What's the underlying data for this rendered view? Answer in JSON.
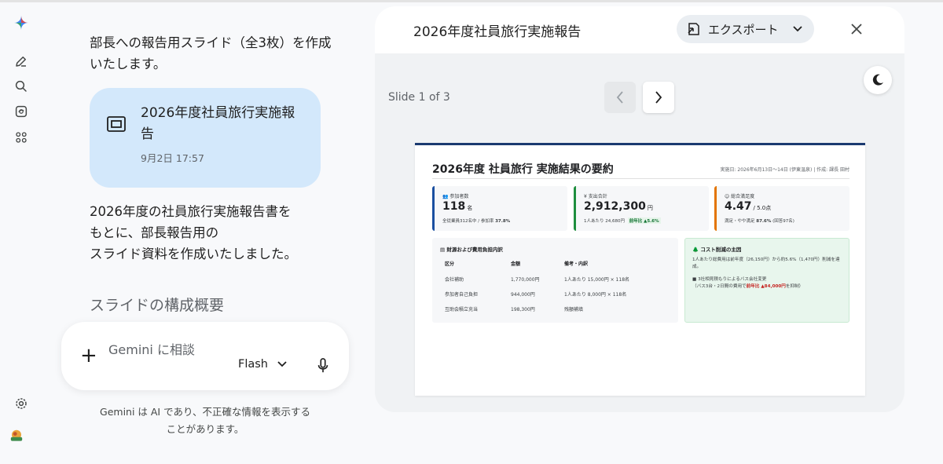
{
  "colors": {
    "accent_blue": "#1a73e8",
    "card_bg": "#d3e8fb",
    "slide_navy": "#1b3a70",
    "kpi_blue": "#1a4fa0",
    "kpi_green": "#1e8e3e",
    "kpi_orange": "#e37400"
  },
  "rail": {
    "icons": [
      "gemini-logo-icon",
      "new-chat-icon",
      "search-icon",
      "gem-icon",
      "apps-icon",
      "settings-icon",
      "avatar"
    ]
  },
  "chat": {
    "msg1": "部長への報告用スライド（全3枚）を作成いたします。",
    "doc_card": {
      "title": "2026年度社員旅行実施報告",
      "date": "9月2日 17:57"
    },
    "msg2_lines": [
      "2026年度の社員旅行実施報告書を",
      "もとに、部長報告用の",
      "スライド資料を作成いたしました。"
    ],
    "section_heading": "スライドの構成概要"
  },
  "input": {
    "placeholder": "Gemini に相談",
    "model": "Flash",
    "disclaimer_line1": "Gemini は AI であり、不正確な情報を表示する",
    "disclaimer_line2": "ことがあります。"
  },
  "panel": {
    "title": "2026年度社員旅行実施報告",
    "export_label": "エクスポート",
    "slide_counter": "Slide 1 of 3"
  },
  "slide": {
    "title": "2026年度 社員旅行 実施結果の要約",
    "meta": "実施日: 2026年6月13日〜14日 (伊東温泉) | 作成: 課長 田村",
    "kpis": [
      {
        "label": "参加者数",
        "value": "118",
        "unit": "名",
        "sub": "全従業員312名中 / 参加率 ",
        "sub_strong": "37.8%",
        "tag": ""
      },
      {
        "label": "¥ 支出合計",
        "value": "2,912,300",
        "unit": "円",
        "sub": "1人あたり 24,680円 ",
        "sub_strong": "",
        "tag": "前年比 ▲5.6%"
      },
      {
        "label": "総合満足度",
        "value": "4.47",
        "unit": "/ 5.0点",
        "sub": "満足・やや満足 ",
        "sub_strong": "87.6%",
        "tag": "",
        "sub_tail": " (回答97名)"
      }
    ],
    "table": {
      "heading": "財源および費用負担内訳",
      "headers": [
        "区分",
        "金額",
        "備考・内訳"
      ],
      "rows": [
        [
          "会社補助",
          "1,770,000円",
          "1人あたり 15,000円 × 118名"
        ],
        [
          "参加者自己負担",
          "944,000円",
          "1人あたり 8,000円 × 118名"
        ],
        [
          "互助会積立充当",
          "198,300円",
          "残額補填"
        ]
      ]
    },
    "cost": {
      "heading": "コスト削減の主因",
      "text1": "1人あたり総費用は前年度（26,150円）から約5.6%（1,470円）削減を達成。",
      "text2a": "■ 3社相見積もりによるバス会社変更",
      "text2b": "（バス3台・2日間の費用で",
      "text2_strong": "前年比 ▲84,000円",
      "text2c": "を抑制）"
    }
  }
}
